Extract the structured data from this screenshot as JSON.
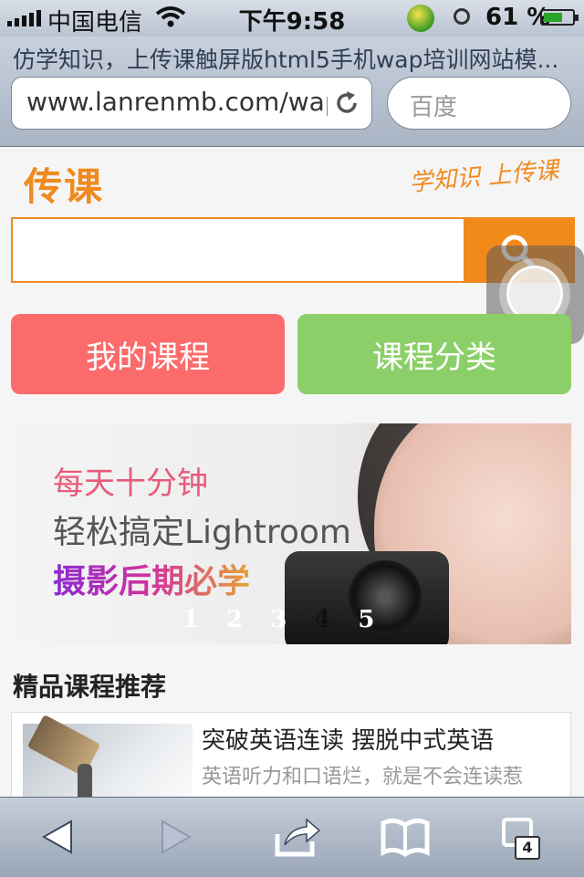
{
  "status_bar": {
    "carrier": "中国电信",
    "time": "下午9:58",
    "battery": "61 %",
    "battery_level": 0.61
  },
  "browser": {
    "page_title": "仿学知识，上传课触屏版html5手机wap培训网站模...",
    "url": "www.lanrenmb.com/wap",
    "search_placeholder": "百度",
    "tabs_count": "4"
  },
  "header": {
    "logo": "传课",
    "slogan": "学知识 上传课"
  },
  "search": {
    "value": ""
  },
  "nav_buttons": {
    "my_courses": "我的课程",
    "categories": "课程分类"
  },
  "banner": {
    "line1": "每天十分钟",
    "line2": "轻松搞定Lightroom",
    "line3": "摄影后期必学",
    "pages": [
      "1",
      "2",
      "3",
      "4",
      "5"
    ],
    "active_page": 4
  },
  "recommend": {
    "title": "精品课程推荐",
    "courses": [
      {
        "title": "突破英语连读 摆脱中式英语",
        "desc": "英语听力和口语烂，就是不会连读惹"
      }
    ]
  },
  "colors": {
    "accent": "#f08a1e",
    "my_courses_bg": "#fc6b6b",
    "categories_bg": "#8ccf69"
  }
}
